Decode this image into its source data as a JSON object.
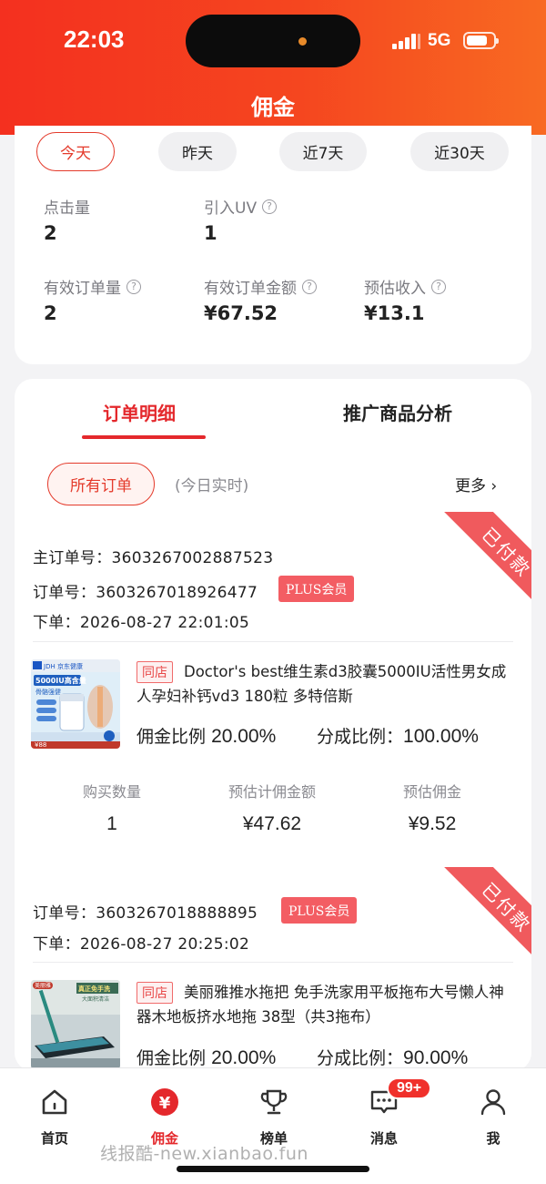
{
  "status_bar": {
    "time": "22:03",
    "network": "5G"
  },
  "header": {
    "title": "佣金"
  },
  "periods": [
    "今天",
    "昨天",
    "近7天",
    "近30天"
  ],
  "stats": {
    "clicks": {
      "label": "点击量",
      "value": "2"
    },
    "uv": {
      "label": "引入UV",
      "value": "1"
    },
    "valid_orders": {
      "label": "有效订单量",
      "value": "2"
    },
    "valid_amount": {
      "label": "有效订单金额",
      "value": "¥67.52"
    },
    "est_income": {
      "label": "预估收入",
      "value": "¥13.1"
    }
  },
  "tabs": {
    "orders": "订单明细",
    "analysis": "推广商品分析"
  },
  "filter": {
    "all": "所有订单",
    "realtime": "(今日实时)",
    "more": "更多 ›"
  },
  "orders": [
    {
      "status": "已付款",
      "main_order_label": "主订单号：",
      "main_order_no": "3603267002887523",
      "order_label": "订单号：",
      "order_no": "3603267018926477",
      "badge": "PLUS会员",
      "time_label": "下单：",
      "time": "2026-08-27 22:01:05",
      "shop_tag": "同店",
      "product_title": "Doctor's best维生素d3胶囊5000IU活性男女成人孕妇补钙vd3 180粒 多特倍斯",
      "commission_rate_label": "佣金比例",
      "commission_rate": "20.00%",
      "share_rate_label": "分成比例：",
      "share_rate": "100.00%",
      "qty_label": "购买数量",
      "qty": "1",
      "est_amount_label": "预估计佣金额",
      "est_amount": "¥47.62",
      "est_commission_label": "预估佣金",
      "est_commission": "¥9.52",
      "thumb": {
        "brand": "JDH 京东健康",
        "headline": "5000IU高含量",
        "sub": "骨骼强健",
        "price": "¥88",
        "colors": {
          "bg": "#dfeef8",
          "accent": "#1f5fbf"
        }
      }
    },
    {
      "status": "已付款",
      "order_label": "订单号：",
      "order_no": "3603267018888895",
      "badge": "PLUS会员",
      "time_label": "下单：",
      "time": "2026-08-27 20:25:02",
      "shop_tag": "同店",
      "product_title": "美丽雅推水拖把 免手洗家用平板拖布大号懒人神器木地板挤水地拖 38型（共3拖布）",
      "commission_rate_label": "佣金比例",
      "commission_rate": "20.00%",
      "share_rate_label": "分成比例：",
      "share_rate": "90.00%",
      "thumb": {
        "brand": "美丽雅",
        "headline": "真正免手洗",
        "sub": "大面积清洁",
        "colors": {
          "bg": "#c9d3d6",
          "accent": "#3a6b55"
        }
      }
    }
  ],
  "tabbar": {
    "items": [
      {
        "label": "首页",
        "icon": "home-icon"
      },
      {
        "label": "佣金",
        "icon": "commission-icon",
        "active": true
      },
      {
        "label": "榜单",
        "icon": "trophy-icon"
      },
      {
        "label": "消息",
        "icon": "message-icon",
        "badge": "99+"
      },
      {
        "label": "我",
        "icon": "user-icon"
      }
    ]
  },
  "watermark": "线报酷-new.xianbao.fun",
  "colors": {
    "brand_red": "#e4282c",
    "header_start": "#f4301f",
    "header_end": "#f86a22",
    "ribbon": "#f05a5d",
    "plus_badge": "#f35d63"
  }
}
